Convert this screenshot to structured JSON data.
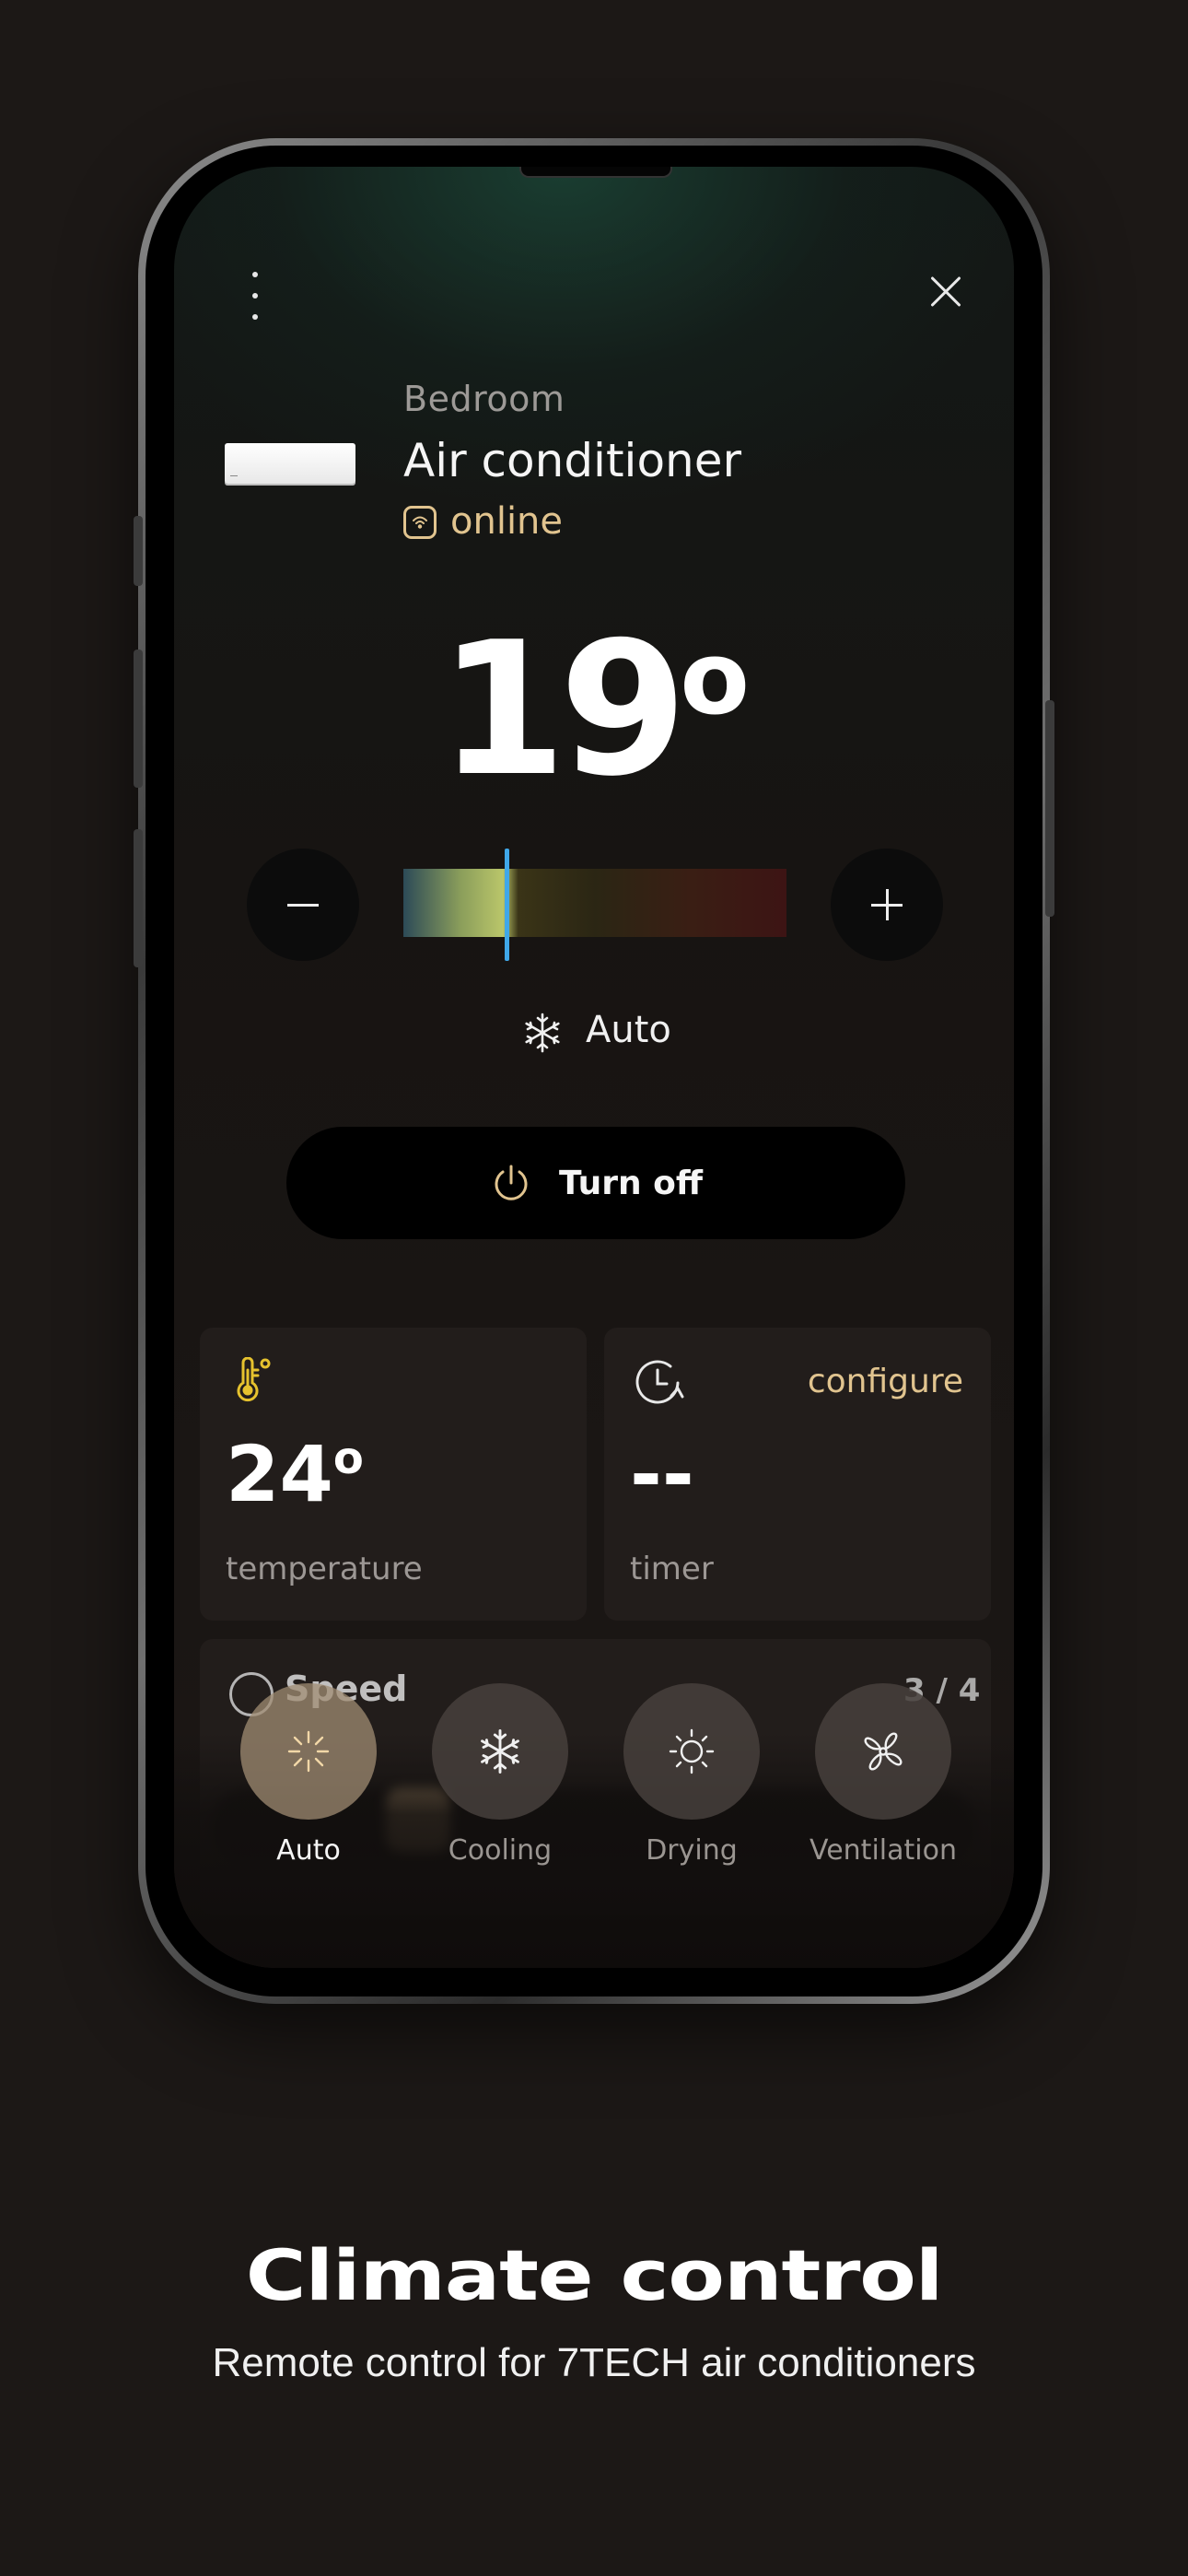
{
  "device": {
    "room": "Bedroom",
    "name": "Air conditioner",
    "status": "online",
    "status_color": "#e1c48f"
  },
  "temperature": {
    "setpoint": "19",
    "degree_symbol": "o",
    "slider_fraction": 0.27
  },
  "current_mode": {
    "icon": "snowflake-icon",
    "label": "Auto"
  },
  "power_button": {
    "icon": "power-icon",
    "label": "Turn off"
  },
  "cards": {
    "temperature": {
      "icon": "thermometer-icon",
      "value": "24",
      "degree_symbol": "o",
      "label": "temperature"
    },
    "timer": {
      "icon": "clock-refresh-icon",
      "value": "--",
      "label": "timer",
      "action": "configure"
    },
    "speed": {
      "icon": "speedometer-icon",
      "label": "Speed",
      "count": "3 / 4"
    }
  },
  "modes": [
    {
      "label": "Auto",
      "icon": "sparkle-icon",
      "active": true
    },
    {
      "label": "Cooling",
      "icon": "snowflake-icon",
      "active": false
    },
    {
      "label": "Drying",
      "icon": "sun-icon",
      "active": false
    },
    {
      "label": "Ventilation",
      "icon": "fan-icon",
      "active": false
    }
  ],
  "promo": {
    "title": "Climate control",
    "subtitle": "Remote control for 7TECH air conditioners"
  },
  "colors": {
    "accent": "#e1c48f",
    "slider_marker": "#3fa7e8",
    "background": "#1c1816",
    "card": "#221d1b"
  }
}
